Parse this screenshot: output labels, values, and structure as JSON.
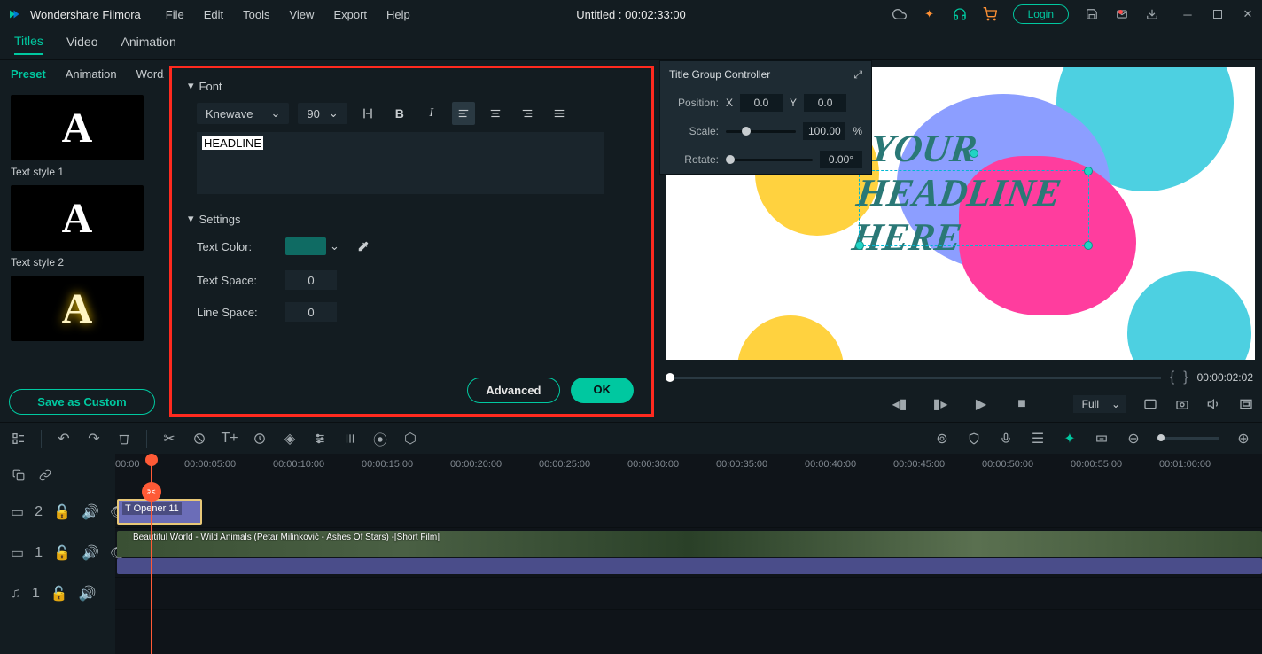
{
  "app": {
    "name": "Wondershare Filmora",
    "docTitle": "Untitled : 00:02:33:00",
    "login": "Login"
  },
  "menus": [
    "File",
    "Edit",
    "Tools",
    "View",
    "Export",
    "Help"
  ],
  "mainTabs": [
    "Titles",
    "Video",
    "Animation"
  ],
  "subTabs": [
    "Preset",
    "Animation",
    "WordArt"
  ],
  "presets": [
    {
      "label": "Text style 1",
      "glyph": "A"
    },
    {
      "label": "Text style 2",
      "glyph": "A"
    },
    {
      "label": "",
      "glyph": "A"
    }
  ],
  "saveCustom": "Save as Custom",
  "editor": {
    "fontSection": "Font",
    "fontFamily": "Knewave",
    "fontSize": "90",
    "text": "HEADLINE",
    "settingsSection": "Settings",
    "textColorLabel": "Text Color:",
    "textColor": "#0f6b63",
    "textSpaceLabel": "Text Space:",
    "textSpace": "0",
    "lineSpaceLabel": "Line Space:",
    "lineSpace": "0",
    "advanced": "Advanced",
    "ok": "OK"
  },
  "floatPanel": {
    "title": "Title Group Controller",
    "positionLabel": "Position:",
    "xLabel": "X",
    "x": "0.0",
    "yLabel": "Y",
    "y": "0.0",
    "scaleLabel": "Scale:",
    "scale": "100.00",
    "scaleUnit": "%",
    "rotateLabel": "Rotate:",
    "rotate": "0.00°"
  },
  "preview": {
    "line1": "YOUR",
    "line2": "HEADLINE",
    "line3": "HERE",
    "time": "00:00:02:02",
    "fit": "Full"
  },
  "ruler": [
    "00:00",
    "00:00:05:00",
    "00:00:10:00",
    "00:00:15:00",
    "00:00:20:00",
    "00:00:25:00",
    "00:00:30:00",
    "00:00:35:00",
    "00:00:40:00",
    "00:00:45:00",
    "00:00:50:00",
    "00:00:55:00",
    "00:01:00:00"
  ],
  "tracks": {
    "t1": "2",
    "t2": "1",
    "a1": "1",
    "titleClip": "Opener 11",
    "videoClip": "Beautiful World - Wild Animals (Petar Milinković - Ashes Of Stars) -[Short Film]"
  }
}
